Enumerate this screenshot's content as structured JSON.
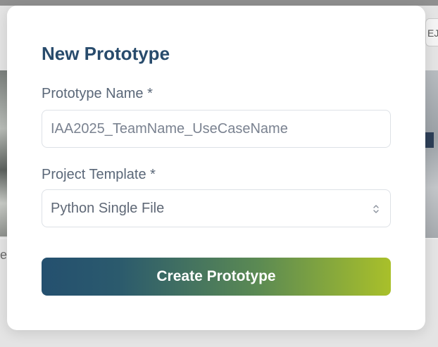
{
  "background": {
    "left_partial_text": "e",
    "right_partial_button": "EJ"
  },
  "modal": {
    "title": "New Prototype",
    "fields": {
      "name": {
        "label": "Prototype Name *",
        "placeholder": "IAA2025_TeamName_UseCaseName",
        "value": ""
      },
      "template": {
        "label": "Project Template *",
        "selected": "Python Single File"
      }
    },
    "submit_label": "Create Prototype"
  },
  "colors": {
    "title": "#284b6c",
    "label": "#5a6778",
    "button_gradient_start": "#24506f",
    "button_gradient_end": "#a9c02a"
  },
  "icons": {
    "select_indicator": "chevron-up-down-icon"
  }
}
